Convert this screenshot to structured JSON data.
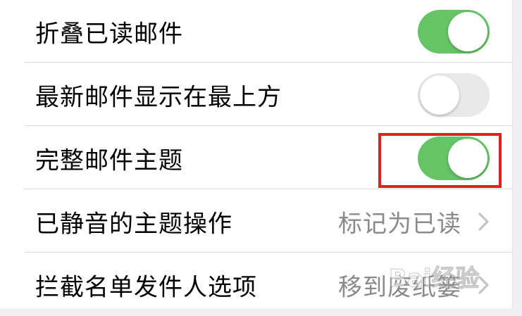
{
  "settings": {
    "rows": [
      {
        "label": "折叠已读邮件",
        "toggle": "on"
      },
      {
        "label": "最新邮件显示在最上方",
        "toggle": "off"
      },
      {
        "label": "完整邮件主题",
        "toggle": "on"
      },
      {
        "label": "已静音的主题操作",
        "value": "标记为已读",
        "chevron": "chevron-right-icon"
      },
      {
        "label": "拦截名单发件人选项",
        "value": "移到废纸篓",
        "chevron": "chevron-right-icon"
      }
    ]
  },
  "colors": {
    "toggle_on": "#65c466",
    "toggle_off": "#e9e9ea",
    "highlight": "#e0201e",
    "secondary_text": "#8a8a8e"
  },
  "watermark": {
    "text": "Bai经验"
  }
}
